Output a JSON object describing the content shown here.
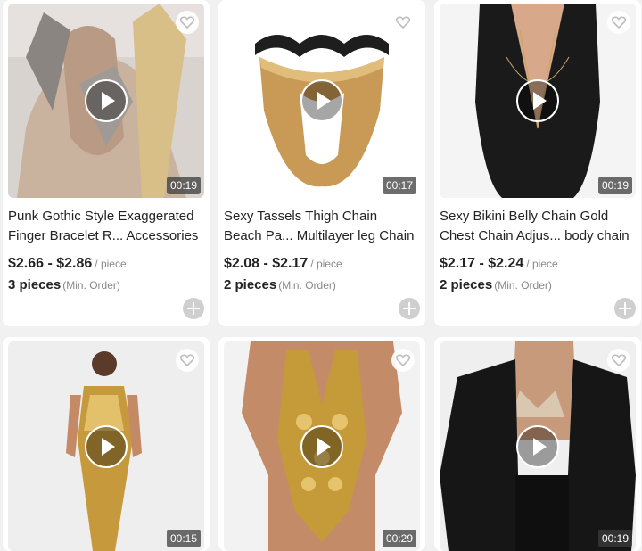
{
  "products": [
    {
      "title_line1": "Punk Gothic Style Exaggerated",
      "title_line2": "Finger Bracelet R... Accessories",
      "price": "$2.66 - $2.86",
      "price_unit": "/ piece",
      "min_order": "3 pieces",
      "min_order_label": "(Min. Order)",
      "duration": "00:19",
      "image": "woman-finger-chain-jewelry-photo"
    },
    {
      "title_line1": "Sexy Tassels Thigh Chain",
      "title_line2": "Beach Pa... Multilayer leg Chain",
      "price": "$2.08 - $2.17",
      "price_unit": "/ piece",
      "min_order": "2 pieces",
      "min_order_label": "(Min. Order)",
      "duration": "00:17",
      "image": "gold-tassel-thigh-chain-photo"
    },
    {
      "title_line1": "Sexy Bikini Belly Chain Gold",
      "title_line2": "Chest Chain Adjus... body chain",
      "price": "$2.17 - $2.24",
      "price_unit": "/ piece",
      "min_order": "2 pieces",
      "min_order_label": "(Min. Order)",
      "duration": "00:19",
      "image": "black-swimsuit-body-chain-photo"
    },
    {
      "duration": "00:15",
      "image": "gold-sequin-dress-photo"
    },
    {
      "duration": "00:29",
      "image": "gold-sequin-bodysuit-photo"
    },
    {
      "duration": "00:19",
      "image": "bikini-top-black-leather-jacket-photo"
    }
  ],
  "colors": {
    "page_bg": "#f1f1f1",
    "card_bg": "#ffffff",
    "text": "#222222",
    "muted": "#888888",
    "add_button": "#cfcfcf"
  },
  "icons": [
    "play-icon",
    "heart-icon",
    "add-circle-icon"
  ]
}
